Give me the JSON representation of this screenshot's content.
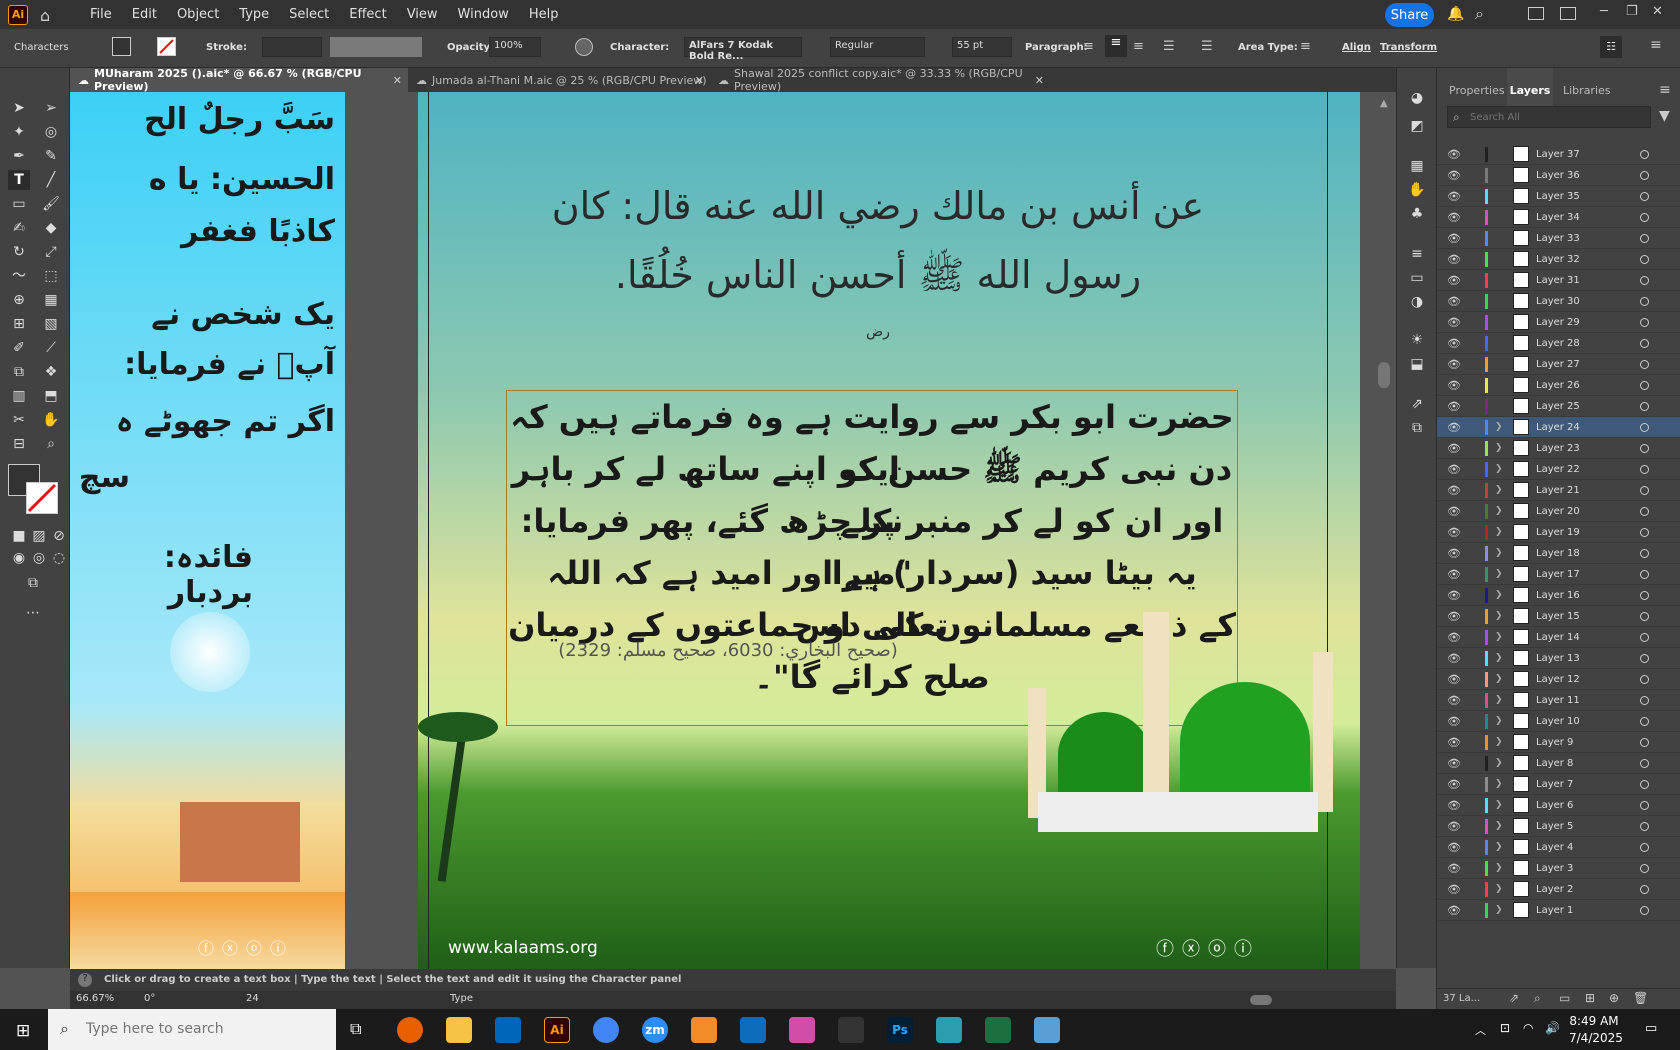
{
  "app": {
    "logo": "Ai",
    "menus": [
      "File",
      "Edit",
      "Object",
      "Type",
      "Select",
      "Effect",
      "View",
      "Window",
      "Help"
    ],
    "share_label": "Share"
  },
  "control": {
    "characters": "Characters",
    "stroke_label": "Stroke:",
    "opacity_label": "Opacity:",
    "opacity_value": "100%",
    "character_label": "Character:",
    "font_family": "AlFars 7 Kodak Bold Re...",
    "font_style": "Regular",
    "font_size": "55 pt",
    "paragraph_label": "Paragraph:",
    "area_type_label": "Area Type:",
    "align_label": "Align",
    "transform_label": "Transform"
  },
  "tabs": [
    {
      "label": "MUharam 2025 ().aic* @ 66.67 % (RGB/CPU Preview)"
    },
    {
      "label": "Jumada al-Thani M.aic @ 25 % (RGB/CPU Preview)"
    },
    {
      "label": "Shawal 2025 conflict copy.aic* @ 33.33 % (RGB/CPU Preview)"
    }
  ],
  "artboard_left": {
    "lines": [
      "سَبَّ رجلٌ الح",
      "الحسين: يا ه",
      "كاذبًا فغفر",
      "یک شخص نے",
      "آپؓ نے فرمایا:",
      "اگر تم جھوٹے ہ",
      "سچ",
      "فائدہ: بردبار"
    ]
  },
  "artboard_main": {
    "arabic_line1": "عن أنس بن مالك رضي الله عنه قال: كان",
    "arabic_line2": "رسول الله ﷺ أحسن الناس خُلُقًا.",
    "small_mark": "رض",
    "urdu_lines": [
      "حضرت ابو بکر سے روایت ہے وہ فرماتے ہیں کہ ایک",
      "دن نبی کریم ﷺ حسن کو اپنے ساتھ لے کر باہر نکلے",
      "اور ان کو لے کر منبر پر چڑھ گئے، پھر فرمایا: \"میرا",
      "یہ بیٹا سید (سردار) ہے اور امید ہے کہ اللہ تعالی اس",
      "کے ذریعے مسلمانوں کی دو جماعتوں کے درمیان",
      "صلح کرائے گا\"۔"
    ],
    "reference": "(صحيح البخاري: 6030، صحيح مسلم: 2329)",
    "website": "www.kalaams.org"
  },
  "status": {
    "hint": "Click or drag to create a text box  |  Type the text  |  Select the text and edit it using the Character panel",
    "zoom": "66.67%",
    "angle": "0°",
    "artboard_num": "24",
    "tool_name": "Type"
  },
  "panel": {
    "tabs": [
      "Properties",
      "Layers",
      "Libraries"
    ],
    "search_placeholder": "Search All",
    "footer_count": "37 La...",
    "layers": [
      {
        "name": "Layer 37",
        "color": "#202020"
      },
      {
        "name": "Layer 36",
        "color": "#7a7a7a"
      },
      {
        "name": "Layer 35",
        "color": "#4fe3ff"
      },
      {
        "name": "Layer 34",
        "color": "#e04cc8"
      },
      {
        "name": "Layer 33",
        "color": "#4f8cff"
      },
      {
        "name": "Layer 32",
        "color": "#43e04f"
      },
      {
        "name": "Layer 31",
        "color": "#ff4040"
      },
      {
        "name": "Layer 30",
        "color": "#36d84a"
      },
      {
        "name": "Layer 29",
        "color": "#b04cff"
      },
      {
        "name": "Layer 28",
        "color": "#3b6cff"
      },
      {
        "name": "Layer 27",
        "color": "#ff9b2e"
      },
      {
        "name": "Layer 26",
        "color": "#e8e84a"
      },
      {
        "name": "Layer 25",
        "color": "#8c1f8c"
      },
      {
        "name": "Layer 24",
        "color": "#4a8cff"
      },
      {
        "name": "Layer 23",
        "color": "#9ee04f"
      },
      {
        "name": "Layer 22",
        "color": "#3b6cff"
      },
      {
        "name": "Layer 21",
        "color": "#c04040"
      },
      {
        "name": "Layer 20",
        "color": "#4a7a2a"
      },
      {
        "name": "Layer 19",
        "color": "#c02020"
      },
      {
        "name": "Layer 18",
        "color": "#8c8cff"
      },
      {
        "name": "Layer 17",
        "color": "#2a9a6a"
      },
      {
        "name": "Layer 16",
        "color": "#1a1a8c"
      },
      {
        "name": "Layer 15",
        "color": "#ff9b2e"
      },
      {
        "name": "Layer 14",
        "color": "#b04cff"
      },
      {
        "name": "Layer 13",
        "color": "#4fe3ff"
      },
      {
        "name": "Layer 12",
        "color": "#ff9b6a"
      },
      {
        "name": "Layer 11",
        "color": "#e04c8c"
      },
      {
        "name": "Layer 10",
        "color": "#1a8c8c"
      },
      {
        "name": "Layer 9",
        "color": "#ff8c2e"
      },
      {
        "name": "Layer 8",
        "color": "#202020"
      },
      {
        "name": "Layer 7",
        "color": "#8c8c8c"
      },
      {
        "name": "Layer 6",
        "color": "#4fe3ff"
      },
      {
        "name": "Layer 5",
        "color": "#e04cc8"
      },
      {
        "name": "Layer 4",
        "color": "#4a8cff"
      },
      {
        "name": "Layer 3",
        "color": "#43e04f"
      },
      {
        "name": "Layer 2",
        "color": "#ff4040"
      },
      {
        "name": "Layer 1",
        "color": "#36d84a"
      }
    ],
    "selected_layer": "Layer 24"
  },
  "taskbar": {
    "search_placeholder": "Type here to search",
    "time": "8:49 AM",
    "date": "7/4/2025"
  }
}
